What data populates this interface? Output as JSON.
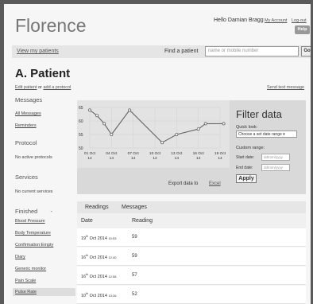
{
  "header": {
    "app_title": "Florence",
    "greeting": "Hello Damian Bragg",
    "my_account": "My Account",
    "logout": "Log-out",
    "help": "Help"
  },
  "topbar": {
    "view_patients": "View my patients",
    "find_label": "Find a patient",
    "search_placeholder": "name or mobile number",
    "go": "Go"
  },
  "patient": {
    "name": "A. Patient",
    "edit_patient": "Edit patient",
    "or": "or",
    "add_protocol": "add a protocol",
    "send_text": "Send text message"
  },
  "sidebar": {
    "messages_head": "Messages",
    "all_messages": "All Messages",
    "reminders": "Reminders",
    "protocol_head": "Protocol",
    "no_protocols": "No active protocols",
    "services_head": "Services",
    "no_services": "No current services",
    "finished_head": "Finished",
    "finished_dash": "-",
    "finished_items": [
      "Blood Pressure",
      "Body Temperature",
      "Confirmation:Empty",
      "Diary",
      "Generic monitor",
      "Pain Scale",
      "Pulse Rate"
    ]
  },
  "chart_data": {
    "type": "line",
    "categories": [
      "01 Oct 14",
      "04 Oct 14",
      "07 Oct 14",
      "10 Oct 14",
      "13 Oct 14",
      "16 Oct 14",
      "19 Oct 14"
    ],
    "ylim": [
      50,
      65
    ],
    "yticks": [
      "65",
      "60",
      "55",
      "50"
    ],
    "x": [
      0,
      1,
      2,
      3,
      5.5,
      10,
      12,
      15,
      16,
      18.5
    ],
    "y": [
      64,
      62,
      59,
      55,
      64,
      52,
      55,
      57,
      59,
      59
    ],
    "line_color": "#666666",
    "background": "#e3e3e3"
  },
  "export": {
    "label": "Export data to",
    "excel": "Excel"
  },
  "filter": {
    "title": "Filter data",
    "quick_look": "Quick look:",
    "select_value": "Choose a set date range ▾",
    "custom_range": "Custom range:",
    "start_label": "Start date:",
    "end_label": "End date:",
    "date_placeholder": "dd/mm/yyyy",
    "apply": "Apply"
  },
  "tabs": [
    "Readings",
    "Messages"
  ],
  "table": {
    "col_date": "Date",
    "col_reading": "Reading",
    "rows": [
      {
        "day": "19",
        "sup": "th",
        "rest": " Oct 2014 ",
        "time": "10:53",
        "reading": "59"
      },
      {
        "day": "16",
        "sup": "th",
        "rest": " Oct 2014 ",
        "time": "12:40",
        "reading": "59"
      },
      {
        "day": "16",
        "sup": "th",
        "rest": " Oct 2014 ",
        "time": "12:08",
        "reading": "57"
      },
      {
        "day": "10",
        "sup": "th",
        "rest": " Oct 2014 ",
        "time": "13:26",
        "reading": "52"
      }
    ]
  }
}
